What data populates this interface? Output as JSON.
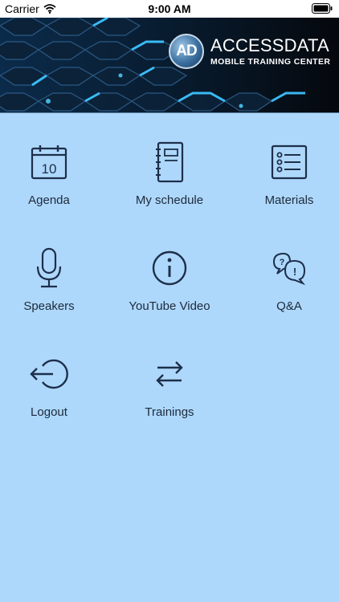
{
  "status_bar": {
    "carrier": "Carrier",
    "time": "9:00 AM"
  },
  "banner": {
    "logo_initials": "AD",
    "brand_name_bold": "ACCESS",
    "brand_name_thin": "DATA",
    "subtitle": "MOBILE TRAINING CENTER"
  },
  "menu": [
    {
      "label": "Agenda",
      "icon": "calendar-icon",
      "calendar_day": "10"
    },
    {
      "label": "My schedule",
      "icon": "notebook-icon"
    },
    {
      "label": "Materials",
      "icon": "checklist-icon"
    },
    {
      "label": "Speakers",
      "icon": "microphone-icon"
    },
    {
      "label": "YouTube Video",
      "icon": "info-icon"
    },
    {
      "label": "Q&A",
      "icon": "speech-bubbles-icon"
    },
    {
      "label": "Logout",
      "icon": "logout-icon"
    },
    {
      "label": "Trainings",
      "icon": "swap-arrows-icon"
    }
  ],
  "colors": {
    "background": "#aed8fb",
    "icon_stroke": "#1d2f4a",
    "banner_bg": "#05080d",
    "banner_glow": "#2fb3ff"
  }
}
